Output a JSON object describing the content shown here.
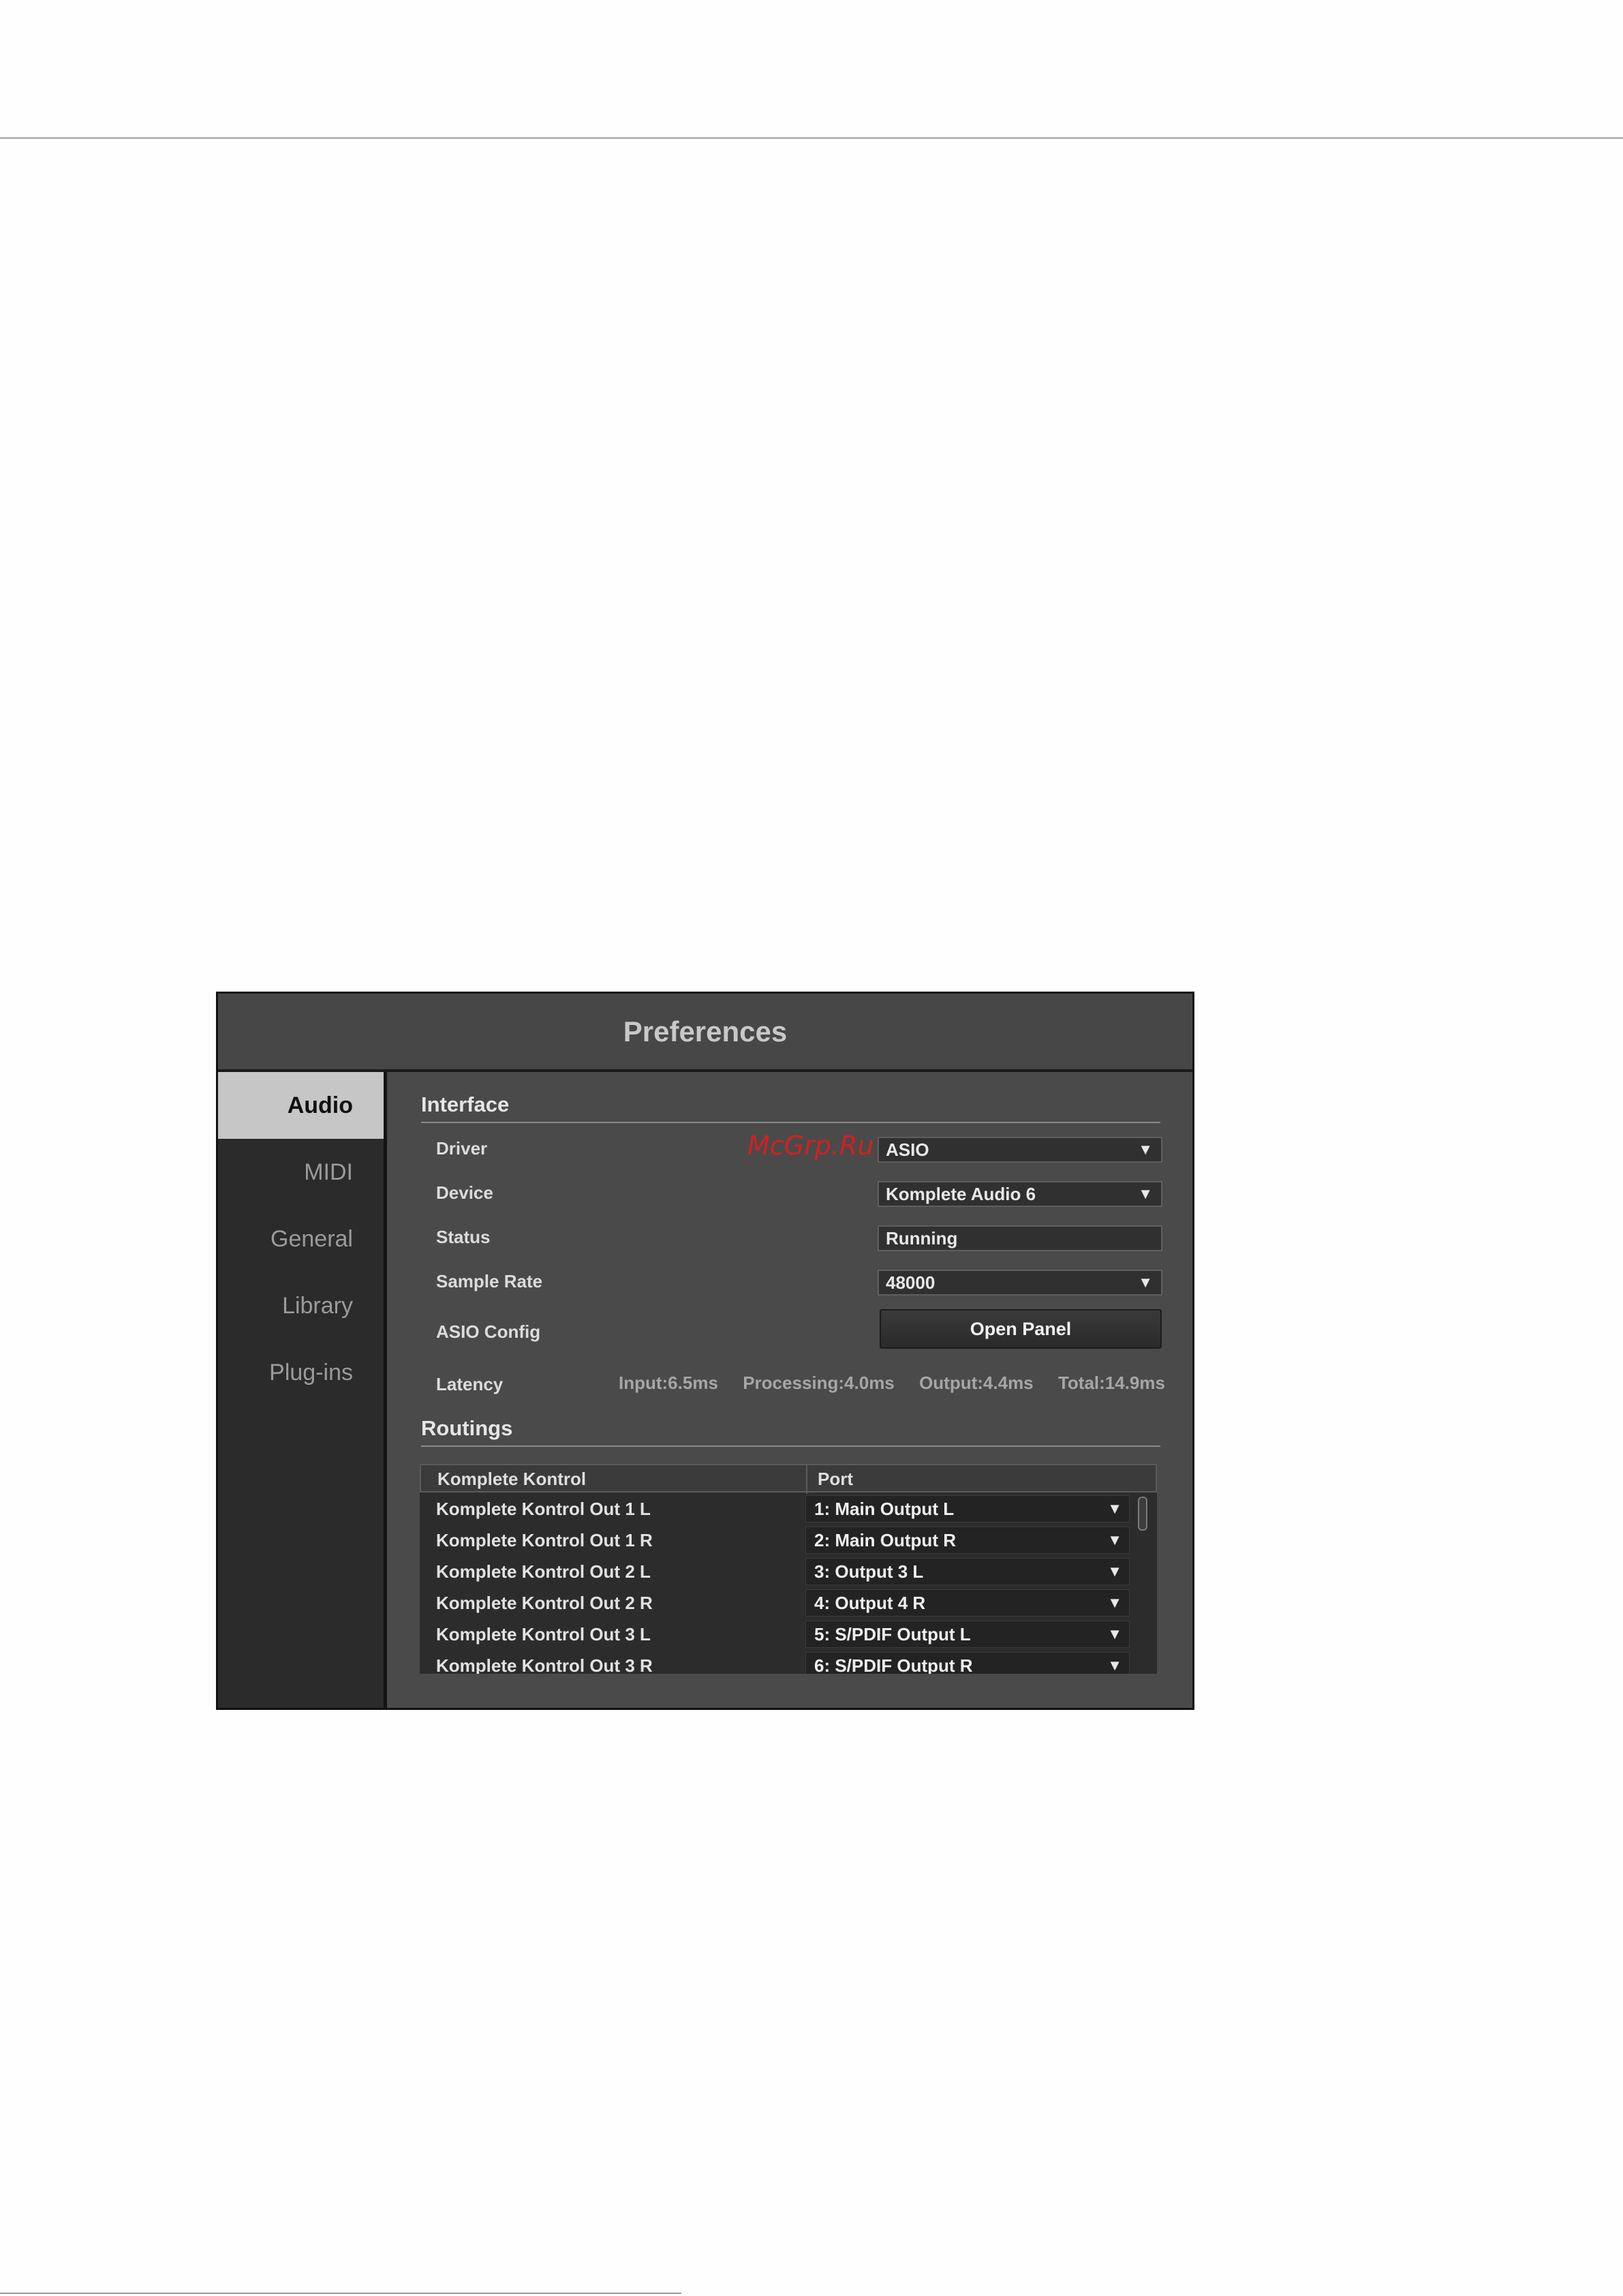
{
  "window": {
    "title": "Preferences"
  },
  "sidebar": {
    "items": [
      {
        "label": "Audio",
        "active": true
      },
      {
        "label": "MIDI",
        "active": false
      },
      {
        "label": "General",
        "active": false
      },
      {
        "label": "Library",
        "active": false
      },
      {
        "label": "Plug-ins",
        "active": false
      }
    ]
  },
  "interface": {
    "title": "Interface",
    "driver": {
      "label": "Driver",
      "value": "ASIO"
    },
    "device": {
      "label": "Device",
      "value": "Komplete Audio 6"
    },
    "status": {
      "label": "Status",
      "value": "Running"
    },
    "sample_rate": {
      "label": "Sample Rate",
      "value": "48000"
    },
    "asio_config": {
      "label": "ASIO Config",
      "button": "Open Panel"
    },
    "latency": {
      "label": "Latency",
      "input": "Input:6.5ms",
      "processing": "Processing:4.0ms",
      "output": "Output:4.4ms",
      "total": "Total:14.9ms"
    }
  },
  "routings": {
    "title": "Routings",
    "columns": [
      "Komplete Kontrol",
      "Port"
    ],
    "rows": [
      {
        "name": "Komplete Kontrol Out 1 L",
        "port": "1: Main Output L"
      },
      {
        "name": "Komplete Kontrol Out 1 R",
        "port": "2: Main Output R"
      },
      {
        "name": "Komplete Kontrol Out 2 L",
        "port": "3: Output 3 L"
      },
      {
        "name": "Komplete Kontrol Out 2 R",
        "port": "4: Output 4 R"
      },
      {
        "name": "Komplete Kontrol Out 3 L",
        "port": "5: S/PDIF Output L"
      },
      {
        "name": "Komplete Kontrol Out 3 R",
        "port": "6: S/PDIF Output R"
      }
    ]
  },
  "watermark": "McGrp.Ru",
  "colors": {
    "accent_active_tab": "#c6c6c6",
    "panel_bg": "#4a4a4a",
    "sidebar_bg": "#2b2b2b",
    "watermark": "#d32020"
  },
  "icons": {
    "dropdown": "caret-down-icon"
  }
}
